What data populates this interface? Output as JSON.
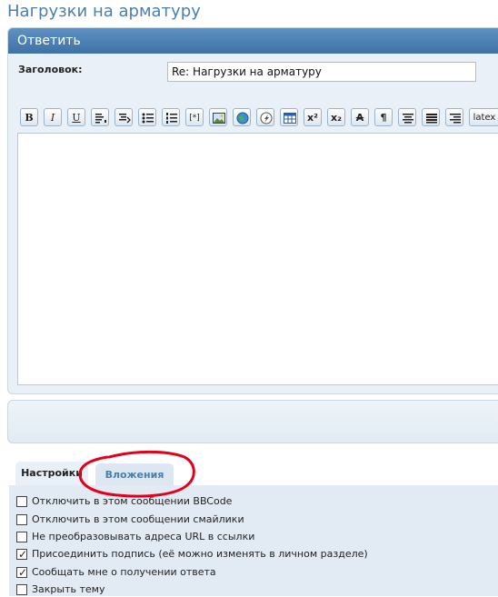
{
  "page": {
    "title": "Нагрузки на арматуру"
  },
  "reply": {
    "header": "Ответить",
    "subject_label": "Заголовок:",
    "subject_value": "Re: Нагрузки на арматуру"
  },
  "toolbar": {
    "buttons": [
      {
        "name": "bold-button",
        "label": "B",
        "icon": "bold"
      },
      {
        "name": "italic-button",
        "label": "I",
        "icon": "italic"
      },
      {
        "name": "underline-button",
        "label": "U",
        "icon": "underline"
      },
      {
        "name": "quote-button",
        "label": "",
        "icon": "quote-icon"
      },
      {
        "name": "code-button",
        "label": "",
        "icon": "code-icon"
      },
      {
        "name": "unordered-list-button",
        "label": "",
        "icon": "bullet-list-icon"
      },
      {
        "name": "ordered-list-button",
        "label": "",
        "icon": "numbered-list-icon"
      },
      {
        "name": "list-item-button",
        "label": "[*]",
        "icon": "list-item"
      },
      {
        "name": "image-button",
        "label": "",
        "icon": "image-icon"
      },
      {
        "name": "link-button",
        "label": "",
        "icon": "globe-icon"
      },
      {
        "name": "flash-button",
        "label": "",
        "icon": "flash-icon"
      },
      {
        "name": "table-button",
        "label": "",
        "icon": "table-icon"
      },
      {
        "name": "superscript-button",
        "label": "x²",
        "icon": "superscript"
      },
      {
        "name": "subscript-button",
        "label": "x₂",
        "icon": "subscript"
      },
      {
        "name": "strike-button",
        "label": "A",
        "icon": "strikethrough"
      },
      {
        "name": "paragraph-button",
        "label": "¶",
        "icon": "pilcrow"
      },
      {
        "name": "align-center-button",
        "label": "",
        "icon": "align-center-icon"
      },
      {
        "name": "justify-button",
        "label": "",
        "icon": "justify-icon"
      },
      {
        "name": "align-right-button",
        "label": "",
        "icon": "align-right-icon"
      },
      {
        "name": "latex-button",
        "label": "latex",
        "icon": "latex"
      }
    ]
  },
  "tabs": {
    "settings": "Настройки",
    "attachments": "Вложения"
  },
  "options": [
    {
      "label": "Отключить в этом сообщении BBCode",
      "checked": false
    },
    {
      "label": "Отключить в этом сообщении смайлики",
      "checked": false
    },
    {
      "label": "Не преобразовывать адреса URL в ссылки",
      "checked": false
    },
    {
      "label": "Присоединить подпись (её можно изменять в личном разделе)",
      "checked": true
    },
    {
      "label": "Сообщать мне о получении ответа",
      "checked": true
    },
    {
      "label": "Закрыть тему",
      "checked": false
    }
  ],
  "colors": {
    "accent": "#4a7fae",
    "header_bg": "#4e82b6",
    "annotation": "#e3001b"
  }
}
